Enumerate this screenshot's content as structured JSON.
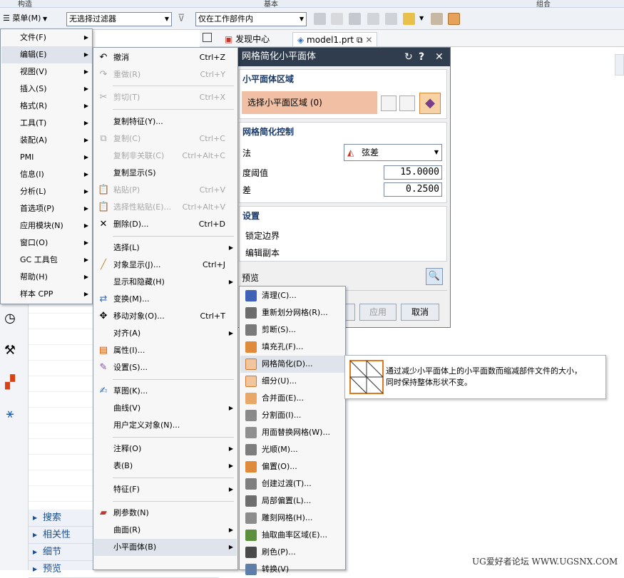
{
  "ribbon": {
    "groups": [
      "构造",
      "基本",
      "组合"
    ]
  },
  "toolbar": {
    "menu_label": "菜单(M)",
    "filter_value": "无选择过滤器",
    "scope_value": "仅在工作部件内"
  },
  "tabs": [
    {
      "label": "发现中心"
    },
    {
      "label": "model1.prt"
    }
  ],
  "main_menu": {
    "items": [
      {
        "label": "文件(F)"
      },
      {
        "label": "编辑(E)"
      },
      {
        "label": "视图(V)"
      },
      {
        "label": "插入(S)"
      },
      {
        "label": "格式(R)"
      },
      {
        "label": "工具(T)"
      },
      {
        "label": "装配(A)"
      },
      {
        "label": "PMI"
      },
      {
        "label": "信息(I)"
      },
      {
        "label": "分析(L)"
      },
      {
        "label": "首选项(P)"
      },
      {
        "label": "应用模块(N)"
      },
      {
        "label": "窗口(O)"
      },
      {
        "label": "GC 工具包"
      },
      {
        "label": "帮助(H)"
      },
      {
        "label": "样本 CPP"
      }
    ]
  },
  "edit_menu": {
    "items": [
      {
        "label": "撤消",
        "shortcut": "Ctrl+Z"
      },
      {
        "label": "重做(R)",
        "shortcut": "Ctrl+Y"
      },
      {
        "label": "剪切(T)",
        "shortcut": "Ctrl+X"
      },
      {
        "label": "复制特征(Y)..."
      },
      {
        "label": "复制(C)",
        "shortcut": "Ctrl+C"
      },
      {
        "label": "复制非关联(C)",
        "shortcut": "Ctrl+Alt+C"
      },
      {
        "label": "复制显示(S)"
      },
      {
        "label": "粘贴(P)",
        "shortcut": "Ctrl+V"
      },
      {
        "label": "选择性粘贴(E)...",
        "shortcut": "Ctrl+Alt+V"
      },
      {
        "label": "删除(D)...",
        "shortcut": "Ctrl+D"
      },
      {
        "label": "选择(L)"
      },
      {
        "label": "对象显示(J)...",
        "shortcut": "Ctrl+J"
      },
      {
        "label": "显示和隐藏(H)"
      },
      {
        "label": "变换(M)..."
      },
      {
        "label": "移动对象(O)...",
        "shortcut": "Ctrl+T"
      },
      {
        "label": "对齐(A)"
      },
      {
        "label": "属性(I)..."
      },
      {
        "label": "设置(S)..."
      },
      {
        "label": "草图(K)..."
      },
      {
        "label": "曲线(V)"
      },
      {
        "label": "用户定义对象(N)..."
      },
      {
        "label": "注释(O)"
      },
      {
        "label": "表(B)"
      },
      {
        "label": "特征(F)"
      },
      {
        "label": "刷参数(N)"
      },
      {
        "label": "曲面(R)"
      },
      {
        "label": "小平面体(B)"
      }
    ]
  },
  "facet_menu": {
    "items": [
      {
        "label": "清理(C)..."
      },
      {
        "label": "重新划分网格(R)..."
      },
      {
        "label": "剪断(S)..."
      },
      {
        "label": "填充孔(F)..."
      },
      {
        "label": "网格简化(D)..."
      },
      {
        "label": "细分(U)..."
      },
      {
        "label": "合并面(E)..."
      },
      {
        "label": "分割面(I)..."
      },
      {
        "label": "用面替换网格(W)..."
      },
      {
        "label": "光顺(M)..."
      },
      {
        "label": "偏置(O)..."
      },
      {
        "label": "创建过渡(T)..."
      },
      {
        "label": "局部偏置(L)..."
      },
      {
        "label": "雕刻网格(H)..."
      },
      {
        "label": "抽取曲率区域(E)..."
      },
      {
        "label": "刷色(P)..."
      },
      {
        "label": "转换(V)"
      }
    ]
  },
  "tooltip": {
    "line1": "通过减少小平面体上的小平面数而缩减部件文件的大小，",
    "line2": "同时保持整体形状不变。"
  },
  "dialog": {
    "title": "网格简化小平面体",
    "region_group": "小平面体区域",
    "select_region": "选择小平面区域 (0)",
    "control_group": "网格简化控制",
    "method_label": "法",
    "method_value": "弦差",
    "threshold_label": "度阈值",
    "threshold_value": "15.0000",
    "tolerance_label": "差",
    "tolerance_value": "0.2500",
    "settings_group": "设置",
    "lock_boundary": "锁定边界",
    "edit_copy": "编辑副本",
    "preview": "预览",
    "apply": "应用",
    "cancel": "取消"
  },
  "accordion": [
    "搜索",
    "相关性",
    "细节",
    "预览"
  ],
  "watermark": "UG爱好者论坛 WWW.UGSNX.COM",
  "colors": {
    "menu_bg": "#f7f7f7",
    "highlight": "#dfe4ec",
    "dialog_title": "#2f3d4f",
    "region_select": "#f1c0a4"
  }
}
